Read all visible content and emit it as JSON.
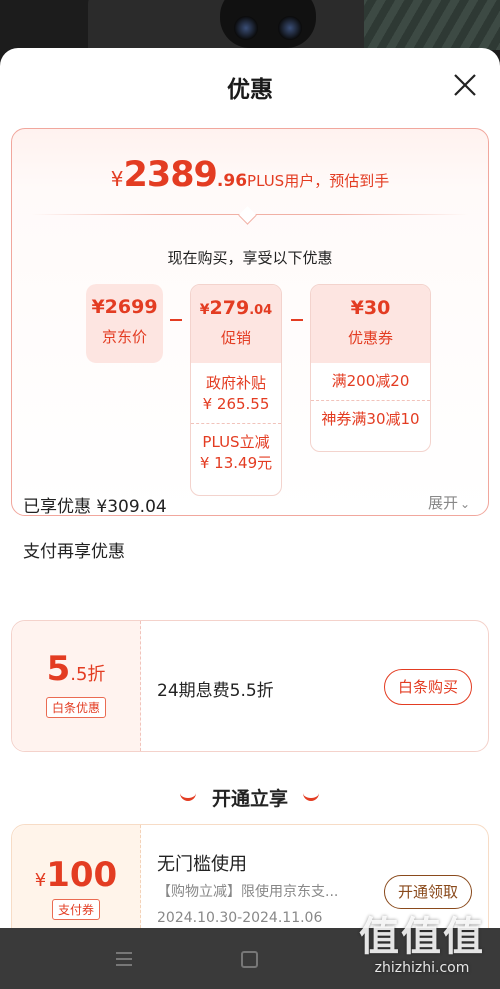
{
  "sheet": {
    "title": "优惠"
  },
  "summary": {
    "currency": "¥",
    "price_int": "2389",
    "price_dec": ".96",
    "price_note": "PLUS用户，预估到手",
    "subtitle": "现在购买，享受以下优惠"
  },
  "breakdown": {
    "base": {
      "value": "¥2699",
      "label": "京东价"
    },
    "promo": {
      "currency": "¥",
      "value_int": "279",
      "value_dec": ".04",
      "label": "促销",
      "items": [
        {
          "name": "政府补贴",
          "amount": "¥ 265.55"
        },
        {
          "name": "PLUS立减",
          "amount": "¥ 13.49元"
        }
      ]
    },
    "coupon": {
      "value": "¥30",
      "label": "优惠券",
      "items": [
        "满200减20",
        "神券满30减10"
      ]
    }
  },
  "saved": {
    "text": "已享优惠 ¥309.04",
    "expand": "展开"
  },
  "payment": {
    "section_title": "支付再享优惠",
    "discount_int": "5",
    "discount_dec": ".5折",
    "tag": "白条优惠",
    "desc": "24期息费5.5折",
    "button": "白条购买"
  },
  "open_section": {
    "title": "开通立享",
    "currency": "¥",
    "amount": "100",
    "tag": "支付券",
    "heading": "无门槛使用",
    "desc": "【购物立减】限使用京东支...",
    "dates": "2024.10.30-2024.11.06",
    "button": "开通领取"
  },
  "watermark": {
    "big": "值值值",
    "small": "zhizhizhi.com"
  },
  "colors": {
    "accent": "#e33c22",
    "accent_light": "#fde5e1",
    "border": "#f1a79d"
  }
}
